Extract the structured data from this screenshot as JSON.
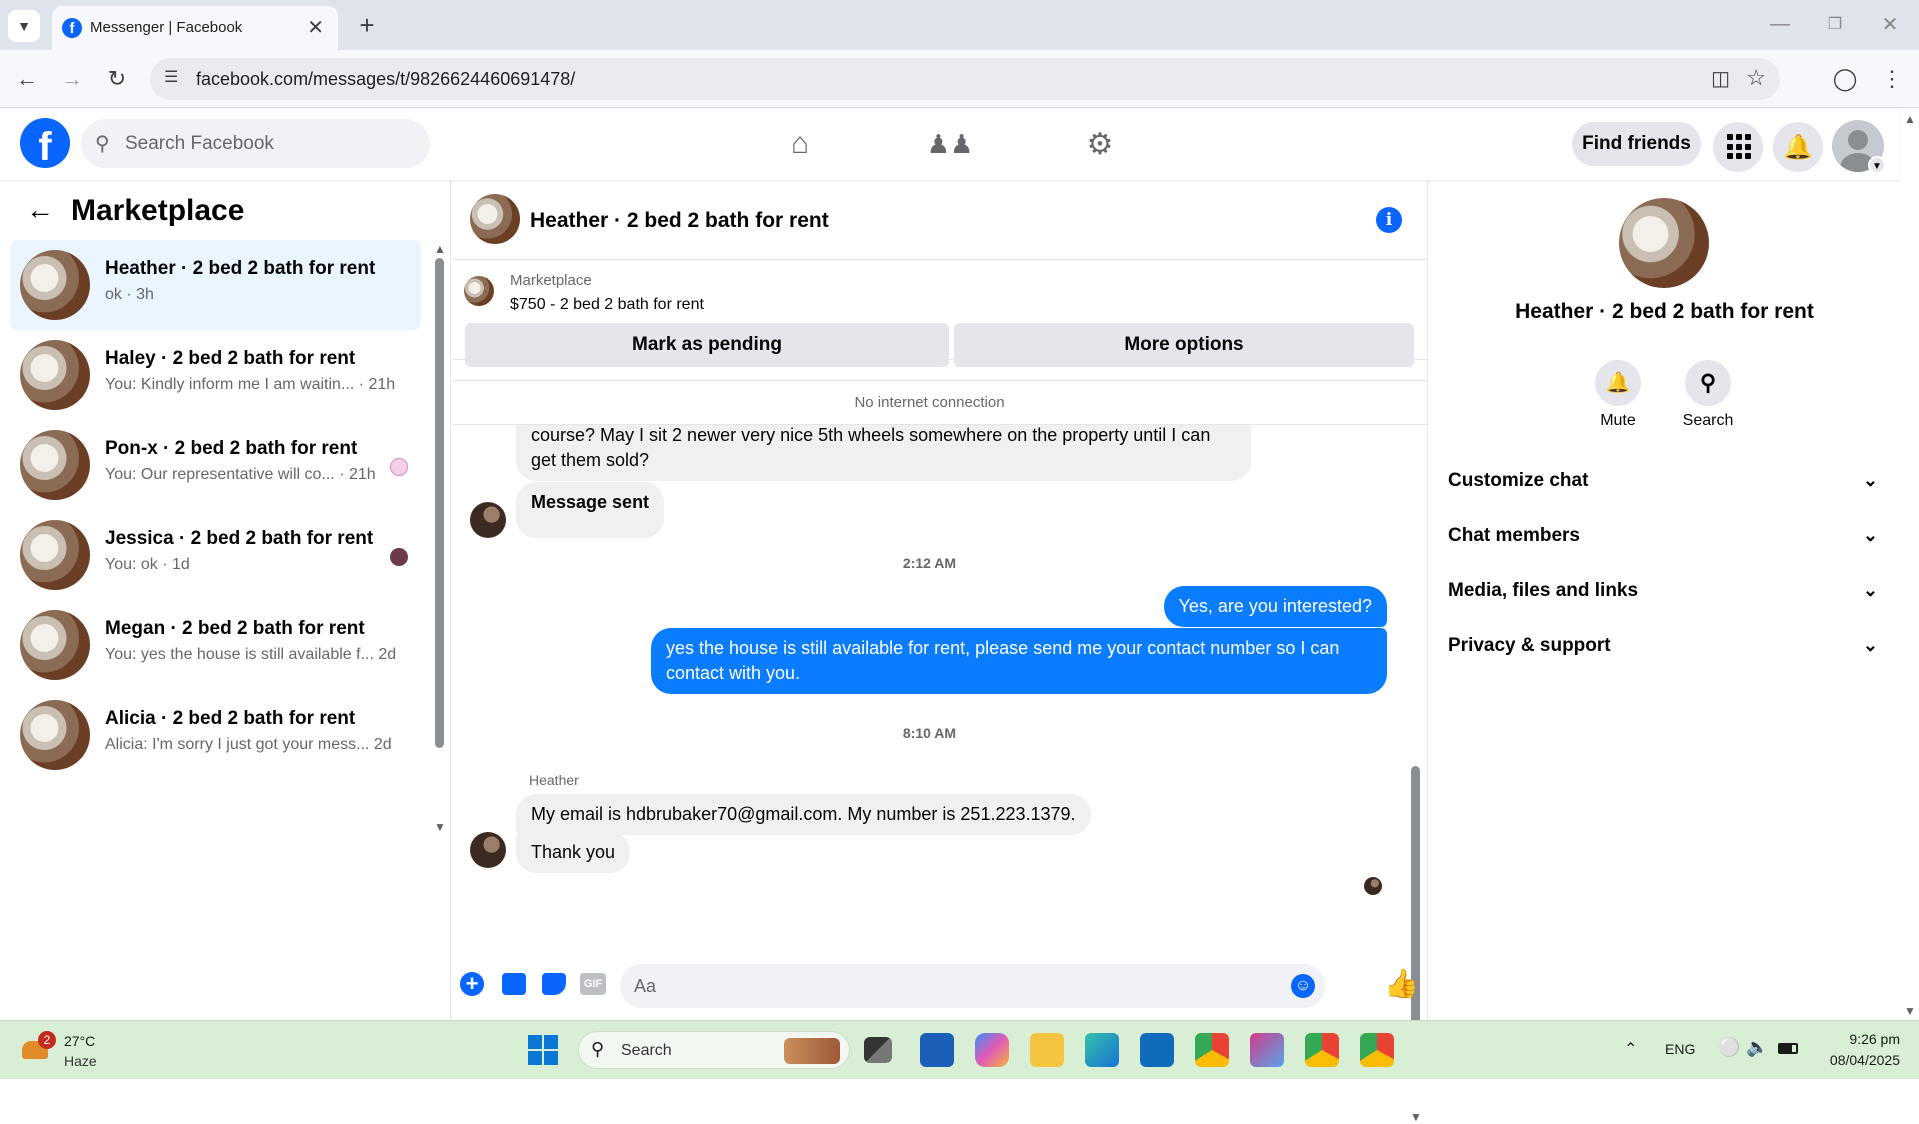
{
  "browser": {
    "tab_title": "Messenger | Facebook",
    "url": "facebook.com/messages/t/9826624460691478/"
  },
  "header": {
    "search_placeholder": "Search Facebook",
    "find_friends": "Find friends"
  },
  "left": {
    "title": "Marketplace",
    "conversations": [
      {
        "name": "Heather · 2 bed 2 bath for rent",
        "preview": "ok · 3h",
        "active": true
      },
      {
        "name": "Haley · 2 bed 2 bath for rent",
        "preview": "You: Kindly inform me I am waitin... · 21h"
      },
      {
        "name": "Pon-x · 2 bed 2 bath for rent",
        "preview": "You: Our representative will co... · 21h"
      },
      {
        "name": "Jessica · 2 bed 2 bath for rent",
        "preview": "You: ok · 1d"
      },
      {
        "name": "Megan · 2 bed 2 bath for rent",
        "preview": "You: yes the house is still available f... 2d"
      },
      {
        "name": "Alicia · 2 bed 2 bath for rent",
        "preview": "Alicia: I'm sorry I just got your mess... 2d"
      }
    ]
  },
  "chat": {
    "title": "Heather · 2 bed 2 bath for rent",
    "listing_label": "Marketplace",
    "listing_price": "$750 - 2 bed 2 bath for rent",
    "mark_pending": "Mark as pending",
    "more_options": "More options",
    "no_internet": "No internet connection",
    "msg_partial": "course?  May I sit 2 newer very nice 5th wheels somewhere on the property until I can get them sold?",
    "msg_sent": "Message sent",
    "time1": "2:12 AM",
    "out1": "Yes, are you interested?",
    "out2": "yes the house is still available for rent, please send me your contact number so I can contact with you.",
    "time2": "8:10 AM",
    "sender": "Heather",
    "in_email": "My email is hdbrubaker70@gmail.com.  My number is 251.223.1379.",
    "in_thanks": "Thank you",
    "composer_placeholder": "Aa"
  },
  "right": {
    "name": "Heather · 2 bed 2 bath for rent",
    "mute": "Mute",
    "search": "Search",
    "sections": [
      "Customize chat",
      "Chat members",
      "Media, files and links",
      "Privacy & support"
    ]
  },
  "taskbar": {
    "weather_temp": "27°C",
    "weather_desc": "Haze",
    "weather_badge": "2",
    "search_label": "Search",
    "lang": "ENG",
    "time": "9:26 pm",
    "date": "08/04/2025"
  },
  "colors": {
    "fb_blue": "#0866ff",
    "bubble_out": "#0a7cff",
    "taskbar_bg": "#d9efd5"
  }
}
